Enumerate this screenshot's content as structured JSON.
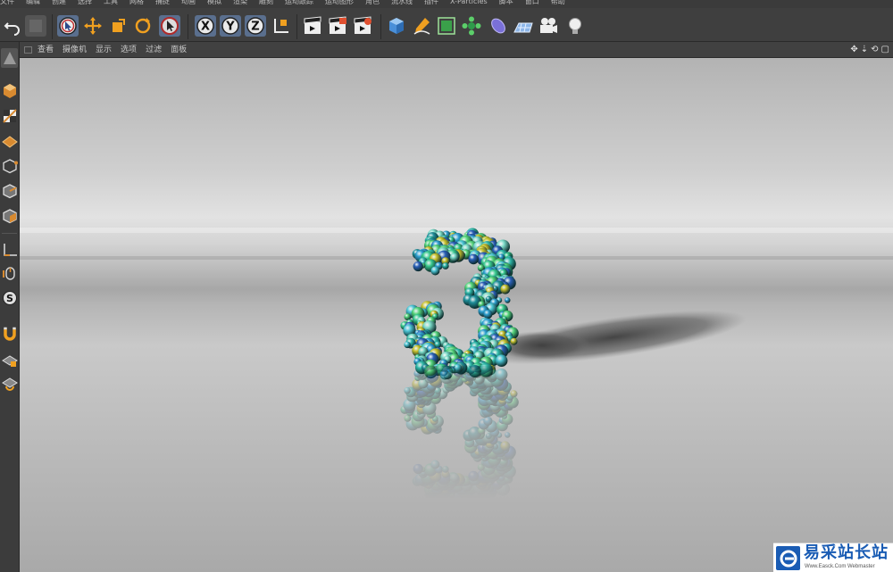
{
  "menu": [
    "文件",
    "编辑",
    "创建",
    "选择",
    "工具",
    "网格",
    "捕捉",
    "动画",
    "模拟",
    "渲染",
    "雕刻",
    "运动跟踪",
    "运动图形",
    "角色",
    "流水线",
    "插件",
    "X-Particles",
    "脚本",
    "窗口",
    "帮助"
  ],
  "toolbar": {
    "axis_x": "X",
    "axis_y": "Y",
    "axis_z": "Z"
  },
  "viewport": {
    "menu": [
      "查看",
      "摄像机",
      "显示",
      "选项",
      "过滤",
      "面板"
    ],
    "controls": [
      "✥",
      "⇣",
      "⟲",
      "▢"
    ]
  },
  "colors": {
    "accent_orange": "#f0a020",
    "selected_blue": "#5a6f8e",
    "brand_blue": "#1a5cb4"
  },
  "watermark": {
    "title": "易采站长站",
    "subtitle": "Www.Easck.Com Webmaster"
  }
}
